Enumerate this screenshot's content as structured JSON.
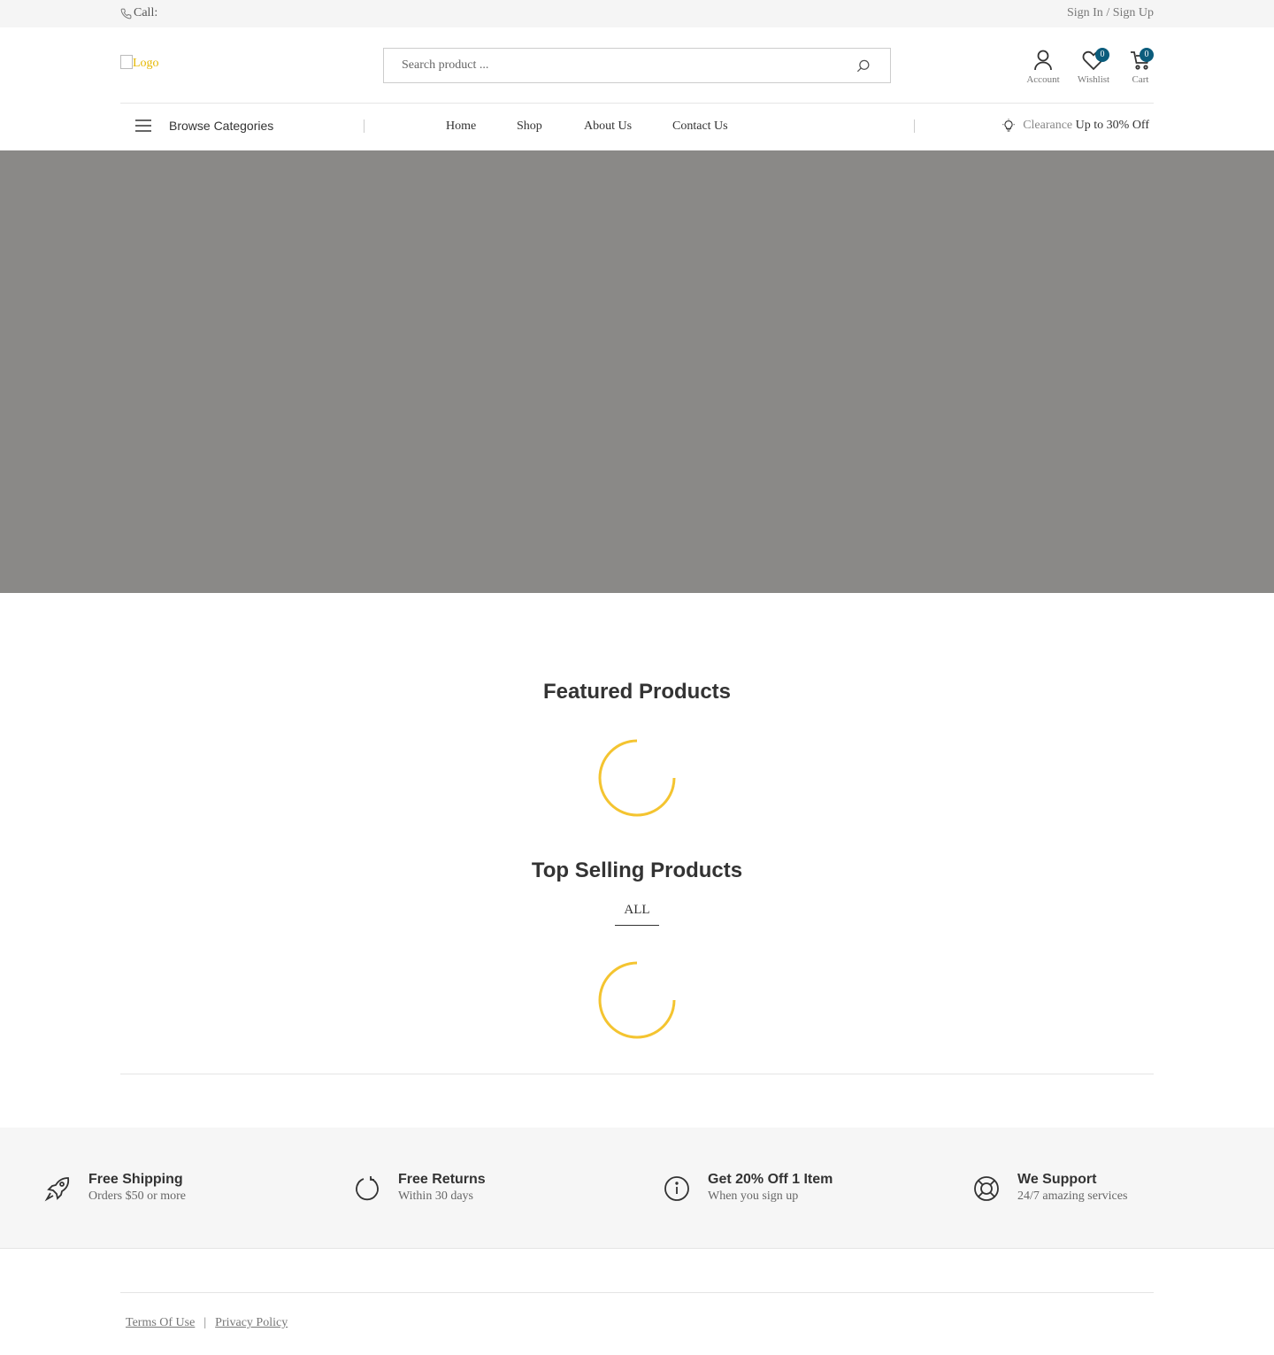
{
  "topbar": {
    "call_label": "Call:",
    "sign_in": "Sign In",
    "separator": " / ",
    "sign_up": "Sign Up"
  },
  "header": {
    "logo_alt": "Logo",
    "search_placeholder": "Search product ...",
    "account_label": "Account",
    "wishlist_label": "Wishlist",
    "wishlist_count": "0",
    "cart_label": "Cart",
    "cart_count": "0"
  },
  "nav": {
    "browse_label": "Browse Categories",
    "items": [
      "Home",
      "Shop",
      "About Us",
      "Contact Us"
    ],
    "clearance_label": "Clearance",
    "clearance_offer": "Up to 30% Off"
  },
  "featured": {
    "title": "Featured Products"
  },
  "top_selling": {
    "title": "Top Selling Products",
    "tab_all": "ALL"
  },
  "features": [
    {
      "icon": "rocket-icon",
      "title": "Free Shipping",
      "subtitle": "Orders $50 or more"
    },
    {
      "icon": "rotate-icon",
      "title": "Free Returns",
      "subtitle": "Within 30 days"
    },
    {
      "icon": "info-icon",
      "title": "Get 20% Off 1 Item",
      "subtitle": "When you sign up"
    },
    {
      "icon": "lifebuoy-icon",
      "title": "We Support",
      "subtitle": "24/7 amazing services"
    }
  ],
  "footer": {
    "terms": "Terms Of Use",
    "separator": "|",
    "privacy": "Privacy Policy"
  },
  "colors": {
    "accent": "#f4c430",
    "badge": "#0b5c7c",
    "hero": "#8a8987",
    "logo_text": "#e6b800"
  }
}
